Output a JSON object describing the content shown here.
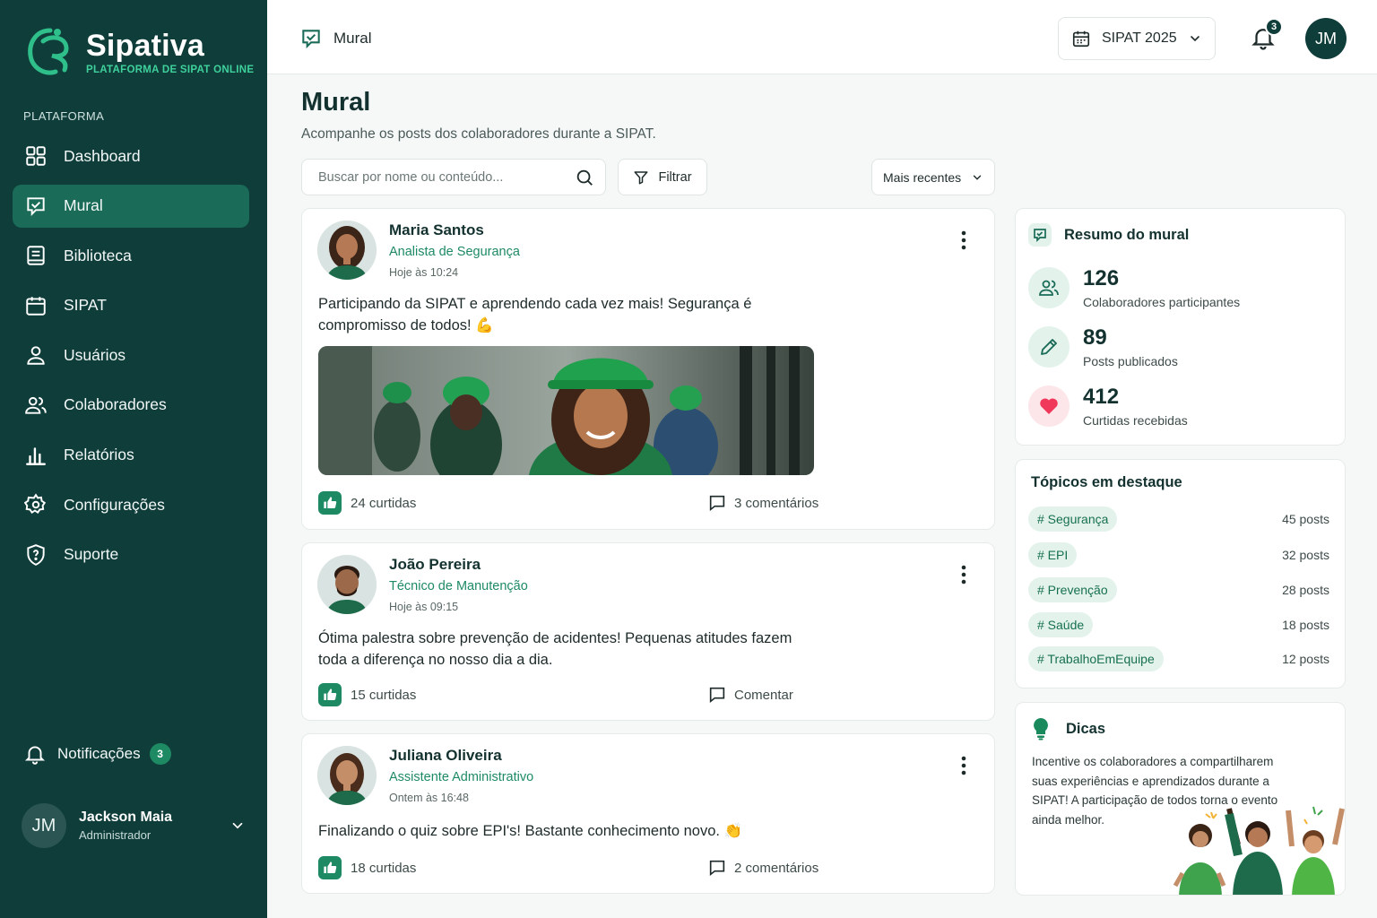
{
  "brand": {
    "name": "Sipativa",
    "tagline": "PLATAFORMA DE SIPAT ONLINE"
  },
  "sidebar": {
    "section": "PLATAFORMA",
    "items": [
      {
        "label": "Dashboard",
        "icon": "dashboard-icon"
      },
      {
        "label": "Mural",
        "icon": "mural-icon",
        "active": true
      },
      {
        "label": "Biblioteca",
        "icon": "library-icon"
      },
      {
        "label": "SIPAT",
        "icon": "calendar-icon"
      },
      {
        "label": "Usuários",
        "icon": "user-icon"
      },
      {
        "label": "Colaboradores",
        "icon": "users-icon"
      },
      {
        "label": "Relatórios",
        "icon": "bar-chart-icon"
      },
      {
        "label": "Configurações",
        "icon": "gear-icon"
      },
      {
        "label": "Suporte",
        "icon": "shield-question-icon"
      }
    ],
    "notifications": {
      "label": "Notificações",
      "count": "3"
    },
    "user": {
      "initials": "JM",
      "name": "Jackson Maia",
      "role": "Administrador"
    }
  },
  "topbar": {
    "breadcrumb": "Mural",
    "sipat_select": "SIPAT 2025",
    "bell_count": "3",
    "avatar_initials": "JM"
  },
  "page": {
    "title": "Mural",
    "subtitle": "Acompanhe os posts dos colaboradores durante a SIPAT.",
    "search_placeholder": "Buscar por nome ou conteúdo...",
    "filter_label": "Filtrar",
    "sort_label": "Mais recentes"
  },
  "posts": [
    {
      "author": "Maria Santos",
      "role": "Analista de Segurança",
      "time": "Hoje às 10:24",
      "text": "Participando da SIPAT e aprendendo cada vez mais! Segurança é compromisso de todos! 💪",
      "has_image": true,
      "likes": "24 curtidas",
      "comments": "3 comentários"
    },
    {
      "author": "João Pereira",
      "role": "Técnico de Manutenção",
      "time": "Hoje às 09:15",
      "text": "Ótima palestra sobre prevenção de acidentes! Pequenas atitudes fazem toda a diferença no nosso dia a dia.",
      "likes": "15 curtidas",
      "comments": "Comentar"
    },
    {
      "author": "Juliana Oliveira",
      "role": "Assistente Administrativo",
      "time": "Ontem às 16:48",
      "text": "Finalizando o quiz sobre EPI's! Bastante conhecimento novo. 👏",
      "likes": "18 curtidas",
      "comments": "2 comentários"
    }
  ],
  "summary": {
    "title": "Resumo do mural",
    "stats": [
      {
        "value": "126",
        "label": "Colaboradores participantes",
        "icon": "users-icon"
      },
      {
        "value": "89",
        "label": "Posts publicados",
        "icon": "pencil-icon"
      },
      {
        "value": "412",
        "label": "Curtidas recebidas",
        "icon": "heart-icon"
      }
    ]
  },
  "topics": {
    "title": "Tópicos em destaque",
    "items": [
      {
        "tag": "# Segurança",
        "count": "45 posts"
      },
      {
        "tag": "# EPI",
        "count": "32 posts"
      },
      {
        "tag": "# Prevenção",
        "count": "28 posts"
      },
      {
        "tag": "# Saúde",
        "count": "18 posts"
      },
      {
        "tag": "# TrabalhoEmEquipe",
        "count": "12 posts"
      }
    ]
  },
  "tips": {
    "title": "Dicas",
    "text": "Incentive os colaboradores a compartilharem suas experiências e aprendizados durante a SIPAT! A participação de todos torna o evento ainda melhor."
  },
  "colors": {
    "sidebar": "#0f3d3a",
    "accent": "#1e8a64",
    "active_nav": "#1a6b57",
    "brand_green": "#3fd19b"
  }
}
